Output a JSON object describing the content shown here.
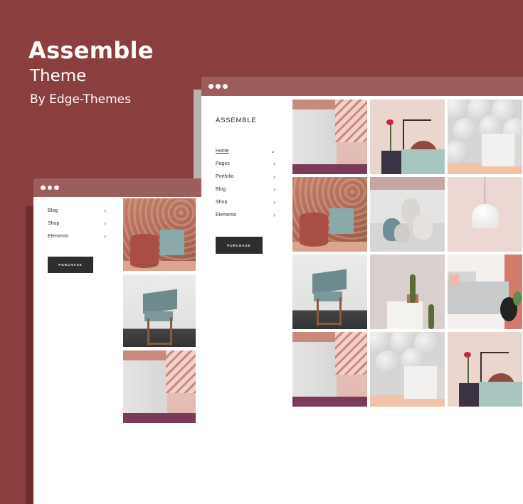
{
  "hero": {
    "title": "Assemble",
    "subtitle": "Theme",
    "byline": "By Edge-Themes"
  },
  "back_window": {
    "nav": [
      {
        "label": "Blog",
        "arrow": "›"
      },
      {
        "label": "Shop",
        "arrow": "›"
      },
      {
        "label": "Elements",
        "arrow": "›"
      }
    ],
    "purchase_label": "PURCHASE"
  },
  "front_window": {
    "brand": "ASSEMBLE",
    "nav": [
      {
        "label": "Home",
        "arrow": "⌄"
      },
      {
        "label": "Pages",
        "arrow": "›"
      },
      {
        "label": "Portfolio",
        "arrow": "›"
      },
      {
        "label": "Blog",
        "arrow": "›"
      },
      {
        "label": "Shop",
        "arrow": "›"
      },
      {
        "label": "Elements",
        "arrow": "›"
      }
    ],
    "purchase_label": "PURCHASE"
  },
  "colors": {
    "background": "#8a3f3e",
    "titlebar": "#9b5e5c",
    "button": "#2e2e2e"
  }
}
